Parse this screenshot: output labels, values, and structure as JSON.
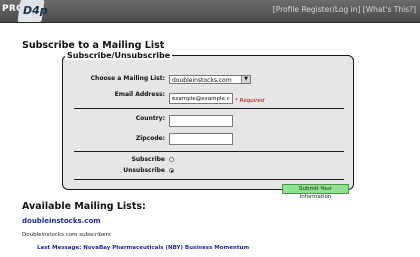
{
  "header": {
    "logo_pro": "PRO",
    "logo_mark": "D4p",
    "links": [
      "[Profile",
      "Register/Log in]",
      "[What's This?]"
    ]
  },
  "main": {
    "title": "Subscribe to a Mailing List",
    "form": {
      "legend": "Subscribe/Unsubscribe",
      "choose_label": "Choose a Mailing List:",
      "choose_value": "doubleinstocks.com",
      "email_label": "Email Address:",
      "email_value": "example@example.com",
      "required_text": "* Required",
      "country_label": "Country:",
      "country_value": "",
      "zipcode_label": "Zipcode:",
      "zipcode_value": "",
      "subscribe_label": "Subscribe",
      "unsubscribe_label": "Unsubscribe",
      "selected_option": "Unsubscribe",
      "submit_label": "Submit Your Information"
    },
    "available": {
      "title": "Available Mailing Lists:",
      "lists": [
        {
          "name": "doubleinstocks.com",
          "subscribers": "Doubleinstocks.com subscribers",
          "last_message": "Last Message: NovaBay Pharmaceuticals (NBY) Business Momentum"
        }
      ]
    }
  },
  "colors": {
    "topbar": "#555555",
    "fieldset_bg": "#e6e6e6",
    "submit_bg": "#8fe08f",
    "link": "#1e2a9a",
    "required": "#b00000"
  }
}
